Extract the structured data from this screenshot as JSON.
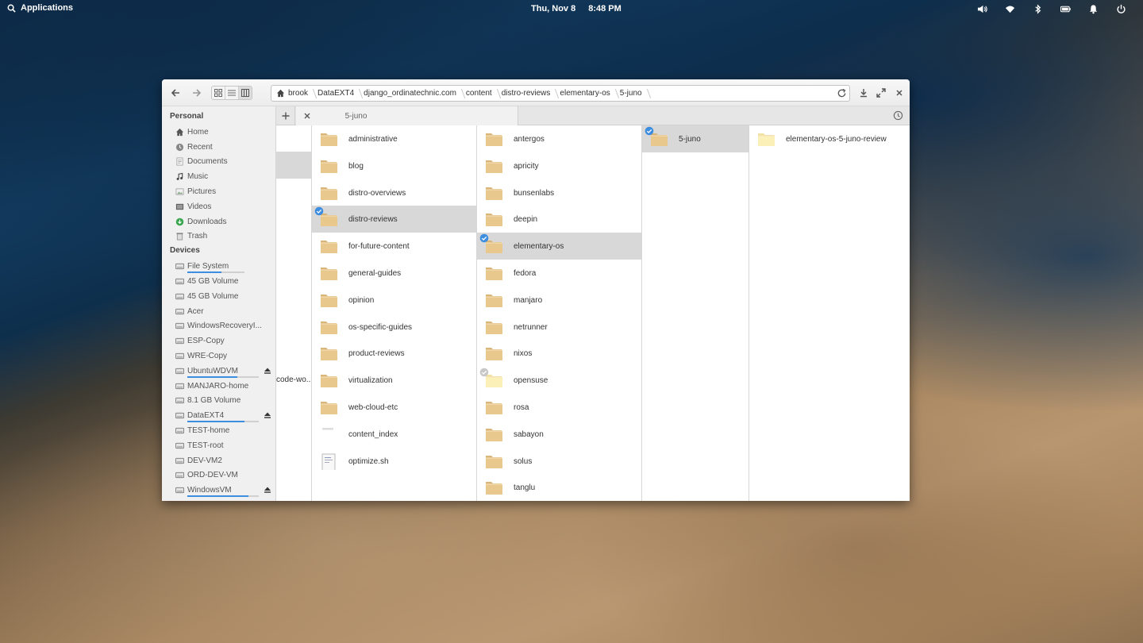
{
  "panel": {
    "applications_label": "Applications",
    "date": "Thu, Nov 8",
    "time": "8:48 PM",
    "indicators": [
      "volume-icon",
      "wifi-icon",
      "bluetooth-icon",
      "battery-icon",
      "notifications-icon",
      "power-icon"
    ]
  },
  "window": {
    "breadcrumbs": [
      "brook",
      "DataEXT4",
      "django_ordinatechnic.com",
      "content",
      "distro-reviews",
      "elementary-os",
      "5-juno"
    ],
    "tab_label": "5-juno"
  },
  "sidebar": {
    "personal_heading": "Personal",
    "personal": [
      {
        "label": "Home",
        "icon": "home-icon"
      },
      {
        "label": "Recent",
        "icon": "recent-icon"
      },
      {
        "label": "Documents",
        "icon": "documents-icon"
      },
      {
        "label": "Music",
        "icon": "music-icon"
      },
      {
        "label": "Pictures",
        "icon": "pictures-icon"
      },
      {
        "label": "Videos",
        "icon": "videos-icon"
      },
      {
        "label": "Downloads",
        "icon": "downloads-icon"
      },
      {
        "label": "Trash",
        "icon": "trash-icon"
      }
    ],
    "devices_heading": "Devices",
    "devices": [
      {
        "label": "File System",
        "usage": 0.6,
        "eject": false
      },
      {
        "label": "45 GB Volume",
        "eject": false
      },
      {
        "label": "45 GB Volume",
        "eject": false
      },
      {
        "label": "Acer",
        "eject": false
      },
      {
        "label": "WindowsRecoveryI...",
        "eject": false
      },
      {
        "label": "ESP-Copy",
        "eject": false
      },
      {
        "label": "WRE-Copy",
        "eject": false
      },
      {
        "label": "UbuntuWDVM",
        "usage": 0.7,
        "eject": true
      },
      {
        "label": "MANJARO-home",
        "eject": false
      },
      {
        "label": "8.1 GB Volume",
        "eject": false
      },
      {
        "label": "DataEXT4",
        "usage": 0.8,
        "eject": true
      },
      {
        "label": "TEST-home",
        "eject": false
      },
      {
        "label": "TEST-root",
        "eject": false
      },
      {
        "label": "DEV-VM2",
        "eject": false
      },
      {
        "label": "ORD-DEV-VM",
        "eject": false
      },
      {
        "label": "WindowsVM",
        "usage": 0.85,
        "eject": true
      }
    ]
  },
  "columns": {
    "col0_partial": "code-wo...",
    "col1": [
      {
        "label": "administrative",
        "type": "folder"
      },
      {
        "label": "blog",
        "type": "folder"
      },
      {
        "label": "distro-overviews",
        "type": "folder"
      },
      {
        "label": "distro-reviews",
        "type": "folder",
        "selected": true
      },
      {
        "label": "for-future-content",
        "type": "folder"
      },
      {
        "label": "general-guides",
        "type": "folder"
      },
      {
        "label": "opinion",
        "type": "folder"
      },
      {
        "label": "os-specific-guides",
        "type": "folder"
      },
      {
        "label": "product-reviews",
        "type": "folder"
      },
      {
        "label": "virtualization",
        "type": "folder"
      },
      {
        "label": "web-cloud-etc",
        "type": "folder"
      },
      {
        "label": "content_index",
        "type": "file"
      },
      {
        "label": "optimize.sh",
        "type": "script"
      }
    ],
    "col2": [
      {
        "label": "antergos",
        "type": "folder"
      },
      {
        "label": "apricity",
        "type": "folder"
      },
      {
        "label": "bunsenlabs",
        "type": "folder"
      },
      {
        "label": "deepin",
        "type": "folder"
      },
      {
        "label": "elementary-os",
        "type": "folder",
        "selected": true
      },
      {
        "label": "fedora",
        "type": "folder"
      },
      {
        "label": "manjaro",
        "type": "folder"
      },
      {
        "label": "netrunner",
        "type": "folder"
      },
      {
        "label": "nixos",
        "type": "folder"
      },
      {
        "label": "opensuse",
        "type": "folder-light",
        "hover": true
      },
      {
        "label": "rosa",
        "type": "folder"
      },
      {
        "label": "sabayon",
        "type": "folder"
      },
      {
        "label": "solus",
        "type": "folder"
      },
      {
        "label": "tanglu",
        "type": "folder"
      }
    ],
    "col3": [
      {
        "label": "5-juno",
        "type": "folder",
        "selected": true
      }
    ],
    "col4": [
      {
        "label": "elementary-os-5-juno-review",
        "type": "folder-light"
      }
    ]
  },
  "dock": {
    "apps": [
      "multitasking-view-icon",
      "web-browser-icon",
      "mail-icon",
      "calendar-icon",
      "music-icon",
      "videos-icon",
      "photos-icon",
      "settings-icon",
      "appcenter-icon",
      "files-icon"
    ]
  },
  "colors": {
    "accent": "#3d8ee0",
    "folder": "#e9c88e",
    "selected_row": "#d8d8d8"
  }
}
